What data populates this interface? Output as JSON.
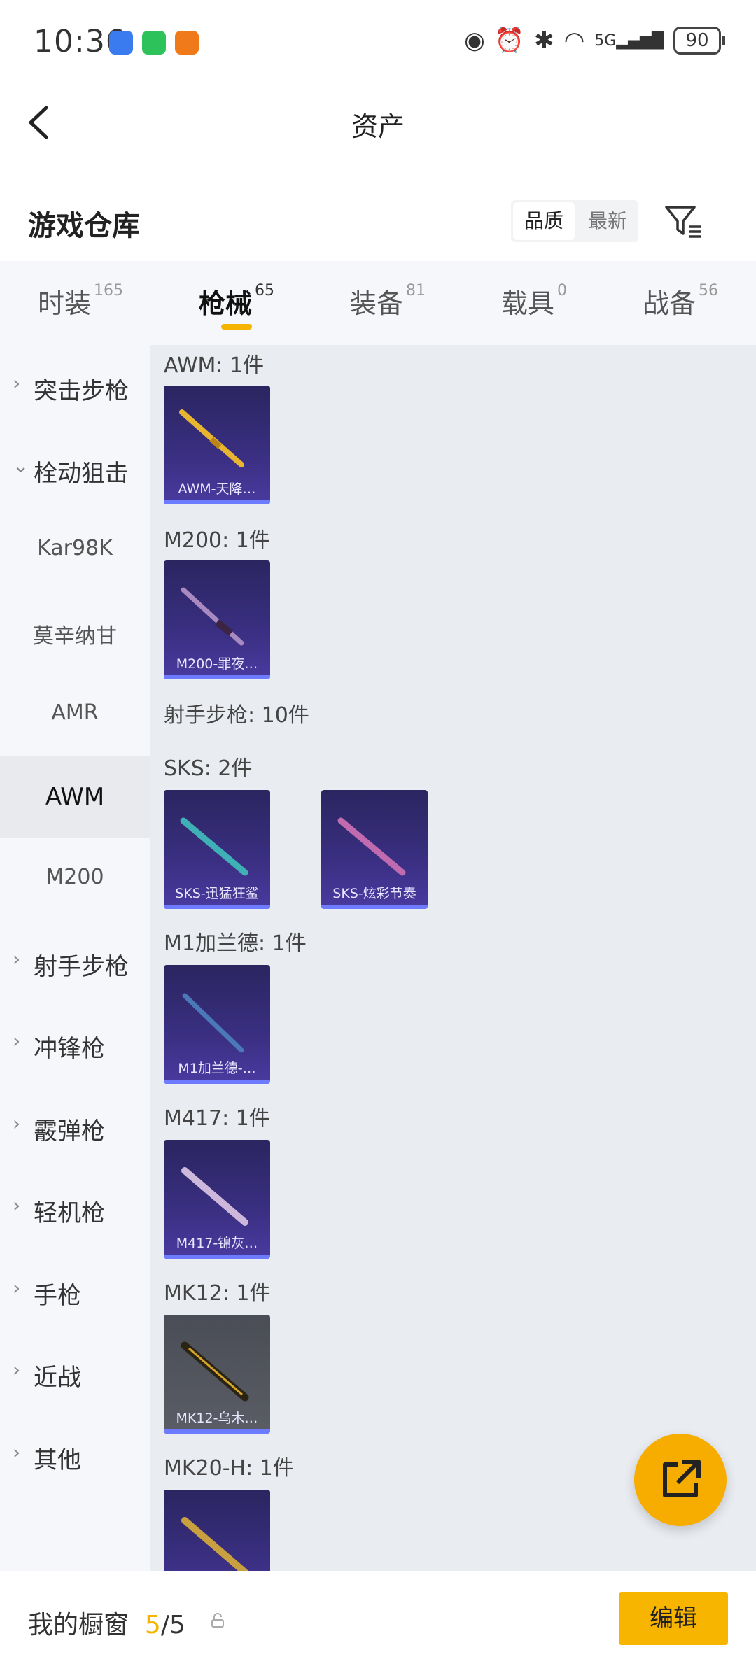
{
  "status": {
    "time": "10:36",
    "battery": "90",
    "network": "5G"
  },
  "titlebar": {
    "title": "资产"
  },
  "header": {
    "title": "游戏仓库",
    "sort_quality": "品质",
    "sort_newest": "最新"
  },
  "tabs": [
    {
      "label": "时装",
      "count": "165"
    },
    {
      "label": "枪械",
      "count": "65"
    },
    {
      "label": "装备",
      "count": "81"
    },
    {
      "label": "载具",
      "count": "0"
    },
    {
      "label": "战备",
      "count": "56"
    }
  ],
  "sidebar": [
    {
      "label": "突击步枪"
    },
    {
      "label": "栓动狙击"
    },
    {
      "label": "Kar98K"
    },
    {
      "label": "莫辛纳甘"
    },
    {
      "label": "AMR"
    },
    {
      "label": "AWM"
    },
    {
      "label": "M200"
    },
    {
      "label": "射手步枪"
    },
    {
      "label": "冲锋枪"
    },
    {
      "label": "霰弹枪"
    },
    {
      "label": "轻机枪"
    },
    {
      "label": "手枪"
    },
    {
      "label": "近战"
    },
    {
      "label": "其他"
    }
  ],
  "content": {
    "groups": [
      "AWM: 1件",
      "M200: 1件",
      "射手步枪: 10件",
      "SKS: 2件",
      "M1加兰德: 1件",
      "M417: 1件",
      "MK12: 1件",
      "MK20-H: 1件"
    ],
    "items": [
      "AWM-天降…",
      "M200-罪夜…",
      "SKS-迅猛狂鲨",
      "SKS-炫彩节奏",
      "M1加兰德-…",
      "M417-锦灰…",
      "MK12-乌木…"
    ]
  },
  "bottombar": {
    "label": "我的橱窗",
    "count_current": "5",
    "count_total": "/5",
    "edit": "编辑"
  },
  "colors": {
    "accent": "#f7b500",
    "card_purple": "#3a2f82"
  }
}
